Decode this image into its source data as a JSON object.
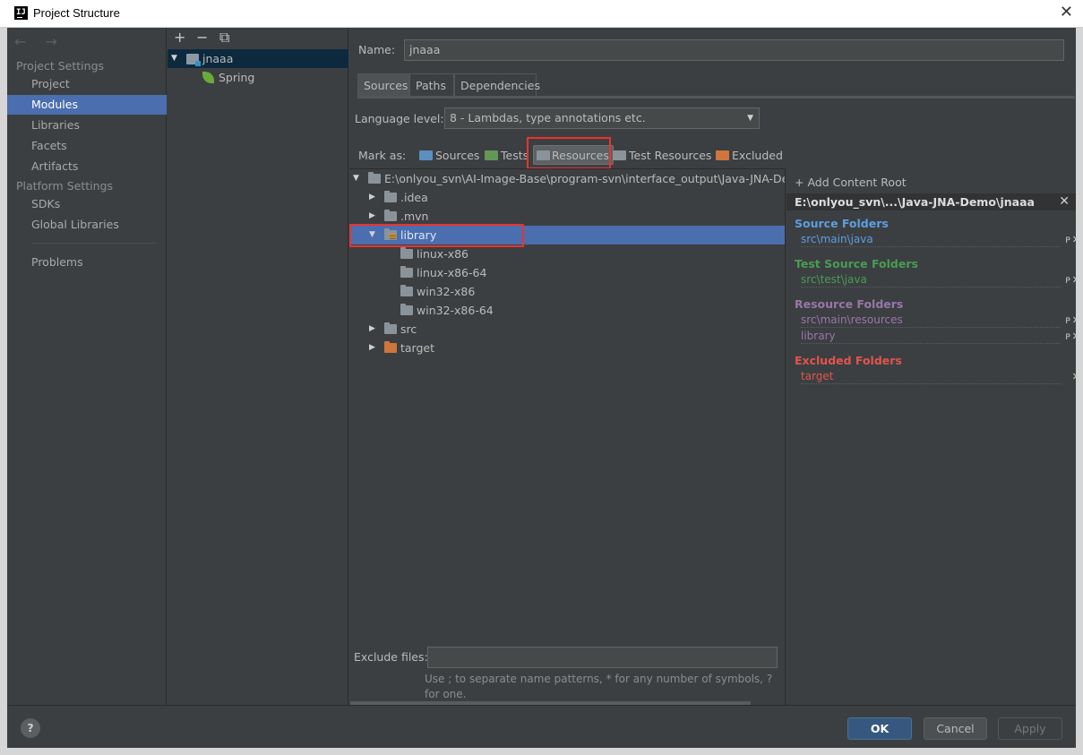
{
  "window": {
    "title": "Project Structure",
    "logo": "IJ",
    "close_glyph": "✕"
  },
  "nav": {
    "back_forward": "← →",
    "section_project": "Project Settings",
    "section_platform": "Platform Settings",
    "items": [
      {
        "label": "Project"
      },
      {
        "label": "Modules"
      },
      {
        "label": "Libraries"
      },
      {
        "label": "Facets"
      },
      {
        "label": "Artifacts"
      },
      {
        "label": "SDKs"
      },
      {
        "label": "Global Libraries"
      },
      {
        "label": "Problems"
      }
    ],
    "selected": "Modules"
  },
  "modules": {
    "toolbar": {
      "add": "+",
      "remove": "−",
      "copy": "⧉"
    },
    "tree": [
      {
        "label": "jnaaa",
        "icon": "module-icon"
      },
      {
        "label": "Spring",
        "icon": "spring-icon"
      }
    ]
  },
  "details": {
    "name_label": "Name:",
    "name_value": "jnaaa",
    "tabs": [
      {
        "label": "Sources"
      },
      {
        "label": "Paths"
      },
      {
        "label": "Dependencies"
      }
    ],
    "active_tab": "Sources",
    "language_label": "Language level:",
    "language_value": "8 - Lambdas, type annotations etc.",
    "mark_as_label": "Mark as:",
    "mark_buttons": [
      {
        "label": "Sources",
        "icon": "folder-blue"
      },
      {
        "label": "Tests",
        "icon": "folder-green"
      },
      {
        "label": "Resources",
        "icon": "folder-resources"
      },
      {
        "label": "Test Resources",
        "icon": "folder-test-resources"
      },
      {
        "label": "Excluded",
        "icon": "folder-orange"
      }
    ],
    "file_tree": [
      {
        "label": "E:\\onlyou_svn\\AI-Image-Base\\program-svn\\interface_output\\Java-JNA-Demo",
        "expander": "▼"
      },
      {
        "label": ".idea",
        "expander": "▶"
      },
      {
        "label": ".mvn",
        "expander": "▶"
      },
      {
        "label": "library",
        "expander": "▼"
      },
      {
        "label": "linux-x86",
        "expander": ""
      },
      {
        "label": "linux-x86-64",
        "expander": ""
      },
      {
        "label": "win32-x86",
        "expander": ""
      },
      {
        "label": "win32-x86-64",
        "expander": ""
      },
      {
        "label": "src",
        "expander": "▶"
      },
      {
        "label": "target",
        "expander": "▶"
      }
    ],
    "exclude_label": "Exclude files:",
    "exclude_value": "",
    "exclude_hint": "Use ; to separate name patterns, * for any number of symbols, ? for one."
  },
  "roots": {
    "add_root": "+ Add Content Root",
    "root_path": "E:\\onlyou_svn\\...\\Java-JNA-Demo\\jnaaa",
    "remove_glyph": "✕",
    "properties_glyph": "P",
    "sections": {
      "source": {
        "title": "Source Folders",
        "entries": [
          "src\\main\\java"
        ],
        "color": "#5c9ee0"
      },
      "test": {
        "title": "Test Source Folders",
        "entries": [
          "src\\test\\java"
        ],
        "color": "#499c54"
      },
      "resource": {
        "title": "Resource Folders",
        "entries": [
          "src\\main\\resources",
          "library"
        ],
        "color": "#9876aa"
      },
      "excluded": {
        "title": "Excluded Folders",
        "entries": [
          "target"
        ],
        "color": "#e0554d"
      }
    }
  },
  "footer": {
    "help": "?",
    "ok": "OK",
    "cancel": "Cancel",
    "apply": "Apply"
  }
}
